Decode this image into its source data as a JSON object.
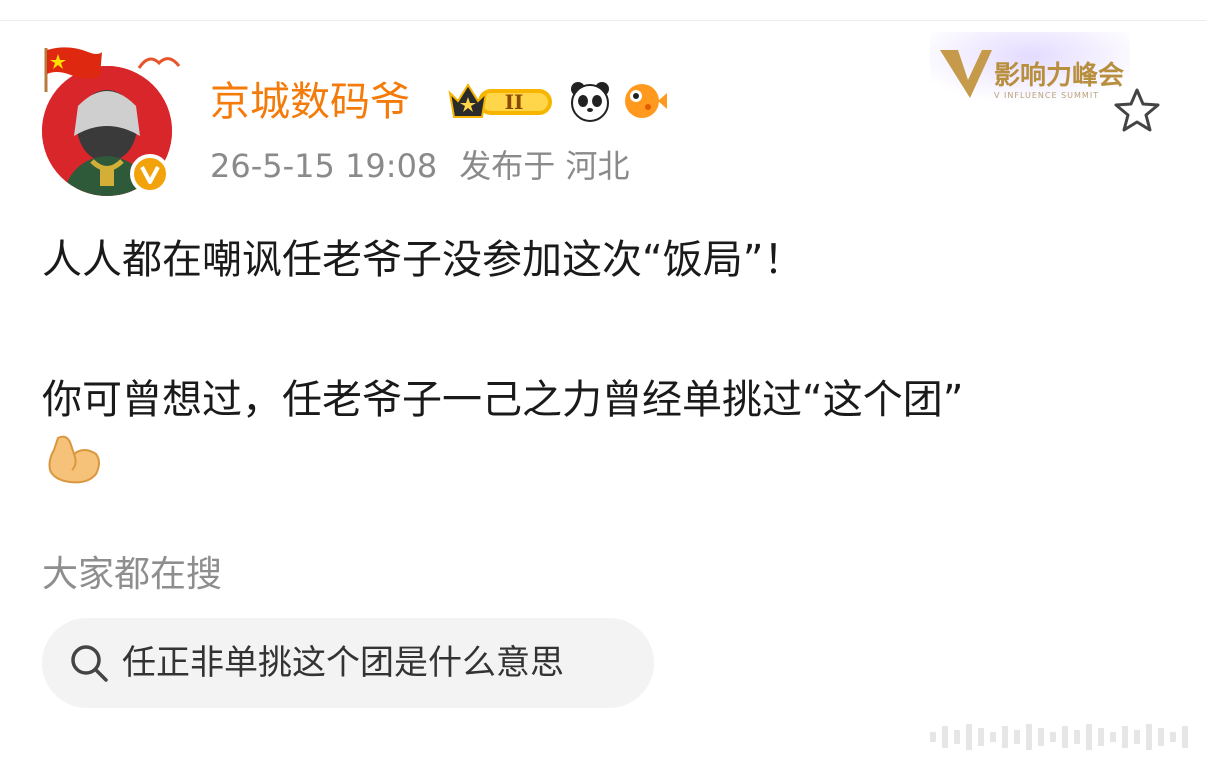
{
  "user": {
    "name": "京城数码爷",
    "level_badge": "II"
  },
  "meta": {
    "timestamp": "26-5-15 19:08",
    "location": "发布于 河北"
  },
  "brand": {
    "logo_text": "影响力峰会",
    "logo_subtext": "V INFLUENCE SUMMIT"
  },
  "post": {
    "line1": "人人都在嘲讽任老爷子没参加这次“饭局”！",
    "line2": "你可曾想过，任老爷子一己之力曾经单挑过“这个团”"
  },
  "search": {
    "section_title": "大家都在搜",
    "query": "任正非单挑这个团是什么意思"
  },
  "colors": {
    "username": "#f47b0a",
    "avatar_bg": "#d9262b",
    "verified_badge": "#f2a20b",
    "meta_text": "#8a8a8a",
    "chip_bg": "#f3f3f3"
  },
  "icons": [
    "flag-icon",
    "verified-v-icon",
    "crown-level-icon",
    "panda-icon",
    "pufferfish-icon",
    "v-influence-logo",
    "star-outline-icon",
    "flexed-biceps-emoji",
    "search-icon",
    "watermark-icon"
  ]
}
